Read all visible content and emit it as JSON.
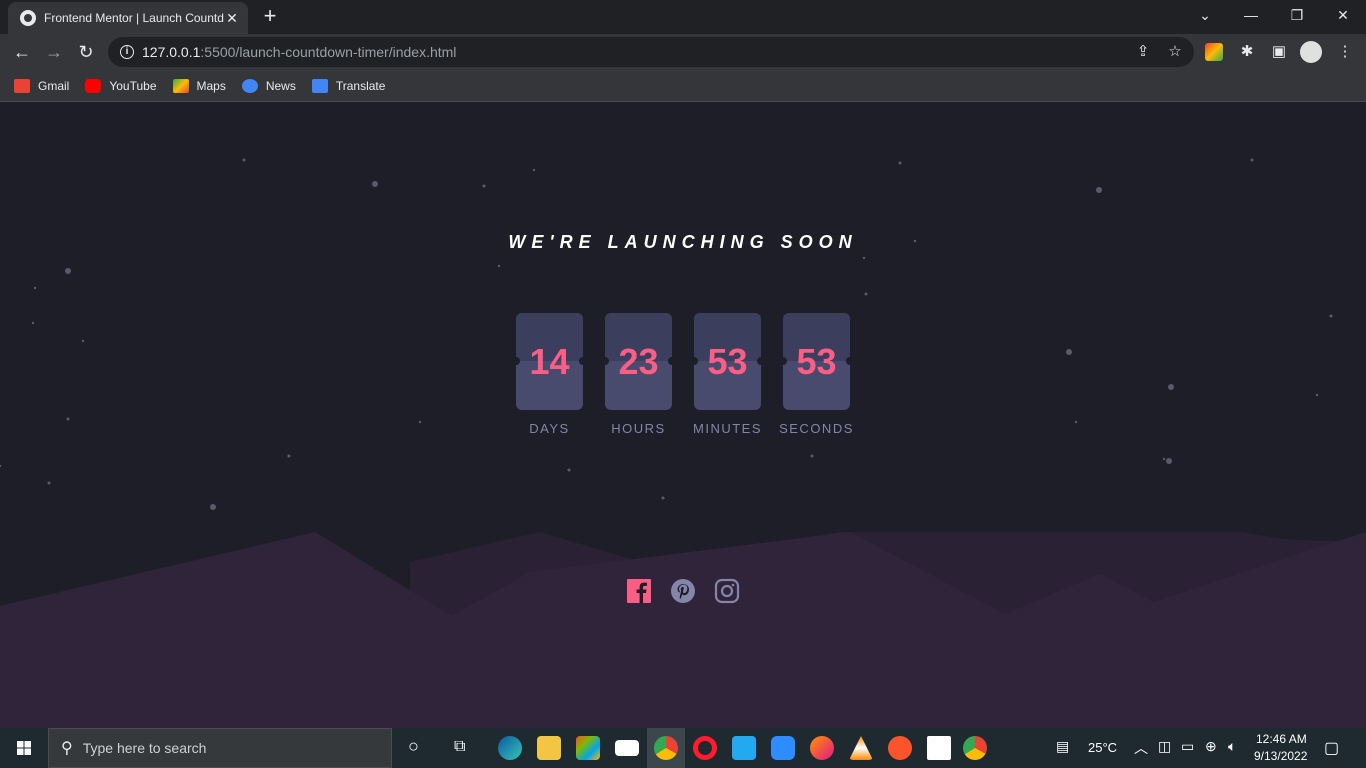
{
  "browser": {
    "tab_title": "Frontend Mentor | Launch Countdown Timer",
    "new_tab_symbol": "+",
    "url_host": "127.0.0.1",
    "url_rest": ":5500/launch-countdown-timer/index.html",
    "bookmarks": [
      {
        "label": "Gmail",
        "icon": "gmail-icon",
        "color": "#ea4335"
      },
      {
        "label": "YouTube",
        "icon": "youtube-icon",
        "color": "#ff0000"
      },
      {
        "label": "Maps",
        "icon": "maps-icon",
        "color": "#34a853"
      },
      {
        "label": "News",
        "icon": "news-icon",
        "color": "#4285f4"
      },
      {
        "label": "Translate",
        "icon": "translate-icon",
        "color": "#4285f4"
      }
    ]
  },
  "page": {
    "headline": "WE'RE LAUNCHING SOON",
    "countdown": [
      {
        "value": "14",
        "label": "DAYS"
      },
      {
        "value": "23",
        "label": "HOURS"
      },
      {
        "value": "53",
        "label": "MINUTES"
      },
      {
        "value": "53",
        "label": "SECONDS"
      }
    ],
    "colors": {
      "background": "#1e1e28",
      "accent": "#fb5e84",
      "card": "#484a6e",
      "label": "#8385a9",
      "hills": "#2f2439"
    },
    "socials": [
      "facebook-icon",
      "pinterest-icon",
      "instagram-icon"
    ]
  },
  "taskbar": {
    "search_placeholder": "Type here to search",
    "apps": [
      "cortana-icon",
      "task-view-icon",
      "edge-icon",
      "file-explorer-icon",
      "store-icon",
      "mail-icon",
      "chrome-icon",
      "opera-icon",
      "vscode-icon",
      "zoom-icon",
      "firefox-icon",
      "vlc-icon",
      "brave-icon",
      "photos-icon",
      "chrome-icon"
    ],
    "temperature": "25°C",
    "time": "12:46 AM",
    "date": "9/13/2022"
  }
}
